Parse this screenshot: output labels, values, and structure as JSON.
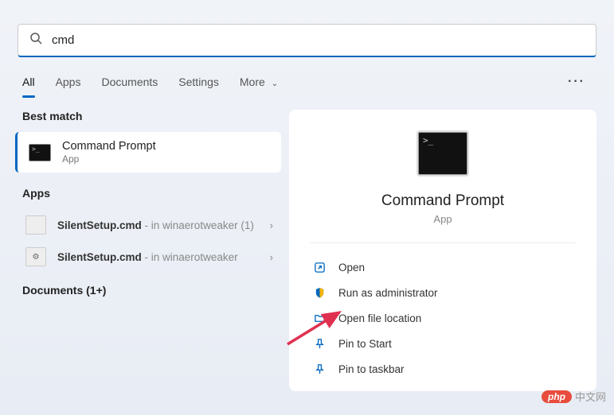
{
  "search": {
    "value": "cmd"
  },
  "tabs": {
    "items": [
      "All",
      "Apps",
      "Documents",
      "Settings",
      "More"
    ],
    "active": 0
  },
  "bestMatch": {
    "heading": "Best match",
    "title": "Command Prompt",
    "subtitle": "App"
  },
  "appsSection": {
    "heading": "Apps",
    "items": [
      {
        "name": "SilentSetup.cmd",
        "location": "in winaerotweaker (1)"
      },
      {
        "name": "SilentSetup.cmd",
        "location": "in winaerotweaker"
      }
    ]
  },
  "documentsHeading": "Documents (1+)",
  "preview": {
    "title": "Command Prompt",
    "subtitle": "App",
    "actions": [
      {
        "icon": "open",
        "label": "Open"
      },
      {
        "icon": "admin",
        "label": "Run as administrator"
      },
      {
        "icon": "folder",
        "label": "Open file location"
      },
      {
        "icon": "pin-start",
        "label": "Pin to Start"
      },
      {
        "icon": "pin-taskbar",
        "label": "Pin to taskbar"
      }
    ]
  },
  "watermark": {
    "badge": "php",
    "text": "中文网"
  }
}
